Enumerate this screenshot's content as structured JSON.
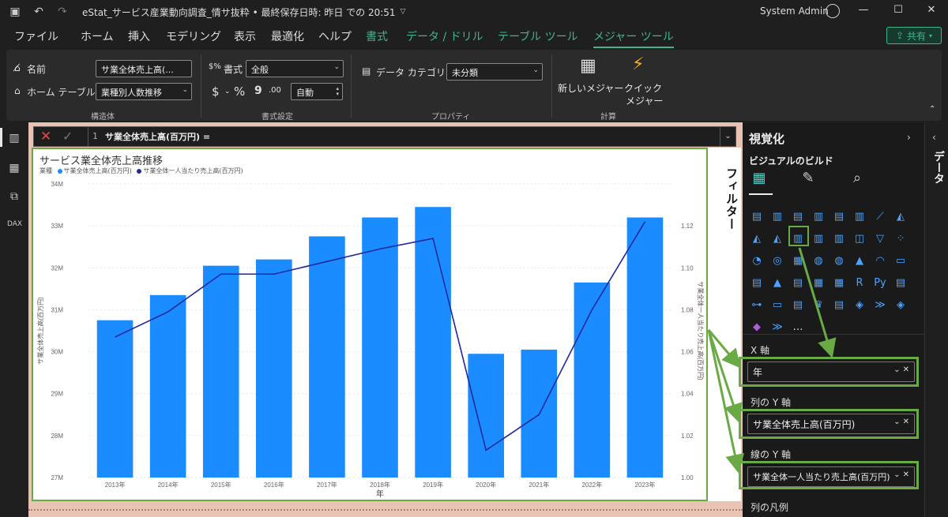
{
  "titlebar": {
    "document_title": "eStat_サービス産業動向調査_情サ抜粋 • 最終保存日時: 昨日 での 20:51",
    "user_name": "System Admin"
  },
  "menu": {
    "file": "ファイル",
    "home": "ホーム",
    "insert": "挿入",
    "modeling": "モデリング",
    "view": "表示",
    "optimize": "最適化",
    "help": "ヘルプ",
    "format": "書式",
    "data_drill": "データ / ドリル",
    "table_tools": "テーブル ツール",
    "measure_tools": "メジャー ツール",
    "share": "共有"
  },
  "ribbon": {
    "name_label": "名前",
    "name_value": "サ業全体売上高(...",
    "home_table_label": "ホーム テーブル",
    "home_table_value": "業種別人数推移",
    "group_structure": "構造体",
    "format_label": "書式",
    "format_value": "全般",
    "currency_symbol": "$",
    "percent_symbol": "%",
    "comma_symbol": "9",
    "decimal_symbol": ".00",
    "auto_value": "自動",
    "group_format": "書式設定",
    "data_category_label": "データ カテゴリ",
    "data_category_value": "未分類",
    "group_properties": "プロパティ",
    "new_measure": "新しいメジャー",
    "quick_measure_1": "クイック",
    "quick_measure_2": "メジャー",
    "group_calc": "計算"
  },
  "formula_bar": {
    "line_number": "1",
    "expression": "サ業全体売上高(百万円) ="
  },
  "filters_label": "フィルター",
  "viz_panel": {
    "title": "視覚化",
    "build_label": "ビジュアルのビルド",
    "x_axis_label": "X 軸",
    "x_axis_value": "年",
    "col_y_label": "列の Y 軸",
    "col_y_value": "サ業全体売上高(百万円)",
    "line_y_label": "線の Y 軸",
    "line_y_value": "サ業全体一人当たり売上高(百万円)",
    "col_legend_label": "列の凡例",
    "more": "…",
    "vis_icons": [
      "stacked-bar-icon",
      "clustered-column-icon",
      "stacked-bar-100-icon",
      "column-icon",
      "clustered-bar-icon",
      "column-100-icon",
      "line-chart-icon",
      "area-chart-icon",
      "stacked-area-icon",
      "ribbon-chart-icon",
      "line-clustered-column-icon",
      "line-stacked-column-icon",
      "waterfall-icon",
      "ribbon-icon",
      "funnel-icon",
      "scatter-icon",
      "pie-chart-icon",
      "donut-chart-icon",
      "treemap-icon",
      "map-icon",
      "filled-map-icon",
      "azure-map-icon",
      "gauge-icon",
      "card-icon",
      "multi-row-card-icon",
      "kpi-icon",
      "slicer-icon",
      "table-icon",
      "matrix-icon",
      "r-visual-icon",
      "python-visual-icon",
      "key-influencers-icon",
      "decomposition-tree-icon",
      "qa-icon",
      "smart-narrative-icon",
      "trophy-icon",
      "paginated-report-icon",
      "power-apps-icon",
      "power-automate-icon",
      "arcgis-icon",
      "diamond-icon",
      "chevrons-icon"
    ]
  },
  "data_panel_label": "データ",
  "colors": {
    "bar": "#1a8cff",
    "line": "#1f2a9b",
    "accent": "#3fb68b",
    "highlight": "#6aaa44"
  },
  "chart_data": {
    "type": "bar",
    "title": "サービス業全体売上高推移",
    "legend_title": "業種",
    "categories": [
      "2013年",
      "2014年",
      "2015年",
      "2016年",
      "2017年",
      "2018年",
      "2019年",
      "2020年",
      "2021年",
      "2022年",
      "2023年"
    ],
    "series": [
      {
        "name": "サ業全体売上高(百万円)",
        "type": "bar",
        "axis": "left",
        "values": [
          30.75,
          31.35,
          32.05,
          32.2,
          32.75,
          33.2,
          33.45,
          29.95,
          30.05,
          31.65,
          33.2
        ]
      },
      {
        "name": "サ業全体一人当たり売上高(百万円)",
        "type": "line",
        "axis": "right",
        "values": [
          1.067,
          1.079,
          1.097,
          1.097,
          1.103,
          1.109,
          1.114,
          1.013,
          1.03,
          1.08,
          1.122
        ]
      }
    ],
    "xlabel": "年",
    "ylabel": "サ業全体売上高(百万円)",
    "y2label": "サ業全体一人当たり売上高(百万円)",
    "ylim": [
      27,
      34
    ],
    "y2lim": [
      1.0,
      1.14
    ],
    "yticks": [
      "27M",
      "28M",
      "29M",
      "30M",
      "31M",
      "32M",
      "33M",
      "34M"
    ],
    "y2ticks": [
      "1.00",
      "1.02",
      "1.04",
      "1.06",
      "1.08",
      "1.10",
      "1.12"
    ],
    "grid": true,
    "legend_position": "top-left"
  }
}
